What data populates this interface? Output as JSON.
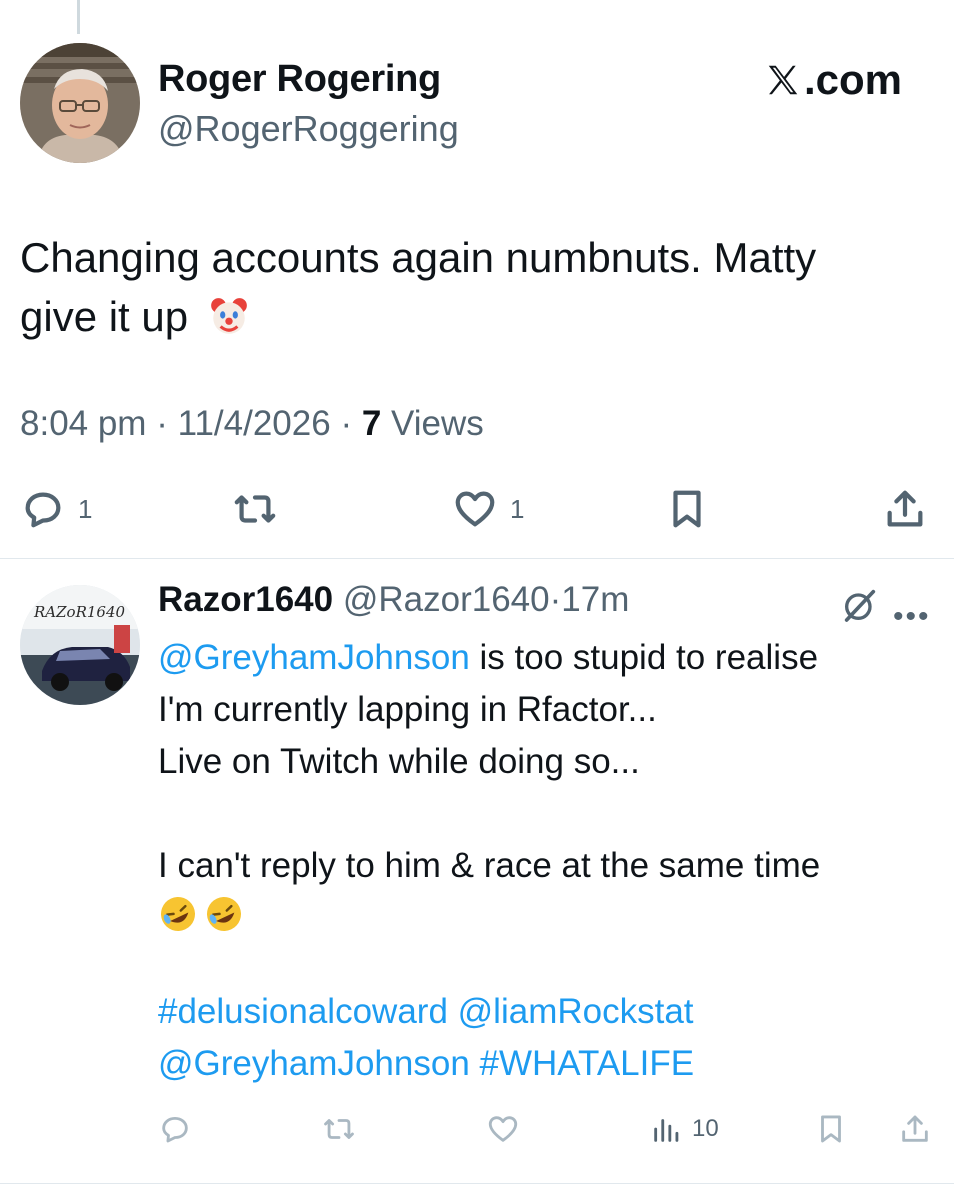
{
  "main_tweet": {
    "display_name": "Roger Rogering",
    "handle": "@RogerRoggering",
    "text_line1": "Changing accounts again numbnuts. Matty",
    "text_line2": "give it up",
    "time": "8:04 pm",
    "date": "11/4/2026",
    "views_count": "7",
    "views_label": "Views",
    "replies": "1",
    "likes": "1"
  },
  "brand": {
    "logo_text": ".com"
  },
  "reply": {
    "display_name": "Razor1640",
    "handle": "@Razor1640",
    "sep": "·",
    "time": "17m",
    "mention1": "@GreyhamJohnson",
    "line1_rest": " is too stupid to realise",
    "line2": "I'm currently lapping in Rfactor...",
    "line3": "Live on Twitch while doing so...",
    "line4": "I can't reply to him & race at the same time",
    "hashtag1": "#delusionalcoward",
    "mention2": "@liamRockstat",
    "mention3": "@GreyhamJohnson",
    "hashtag2": "#WHATALIFE",
    "views": "10",
    "avatar_text": "RAZoR1640"
  },
  "icons": {
    "reply": "reply-icon",
    "retweet": "retweet-icon",
    "like": "heart-icon",
    "bookmark": "bookmark-icon",
    "share": "share-icon",
    "views": "views-chart-icon",
    "grok": "grok-icon",
    "more": "more-icon",
    "emoji_clown": "clown-emoji",
    "emoji_rofl": "rofl-emoji"
  },
  "colors": {
    "link": "#1d9bf0",
    "secondary_text": "#536471",
    "primary_text": "#0f1419"
  }
}
